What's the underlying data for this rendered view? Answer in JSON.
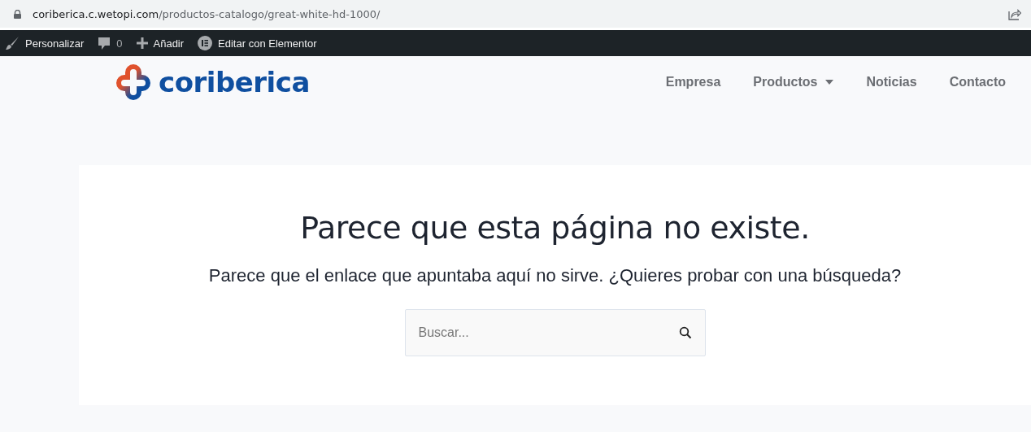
{
  "browser": {
    "url_domain": "coriberica.c.wetopi.com",
    "url_path": "/productos-catalogo/great-white-hd-1000/"
  },
  "admin_bar": [
    {
      "kind": "brush",
      "label": "Personalizar"
    },
    {
      "kind": "comments",
      "label": "0"
    },
    {
      "kind": "add",
      "label": "Añadir"
    },
    {
      "kind": "elementor",
      "label": "Editar con Elementor"
    }
  ],
  "header": {
    "brand": "coriberica",
    "nav": [
      {
        "label": "Empresa",
        "kind": "link"
      },
      {
        "label": "Productos",
        "kind": "dropdown"
      },
      {
        "label": "Noticias",
        "kind": "link"
      },
      {
        "label": "Contacto",
        "kind": "link"
      }
    ]
  },
  "content": {
    "title": "Parece que esta página no existe.",
    "message": "Parece que el enlace que apuntaba aquí no sirve. ¿Quieres probar con una búsqueda?",
    "search": {
      "placeholder": "Buscar..."
    }
  }
}
